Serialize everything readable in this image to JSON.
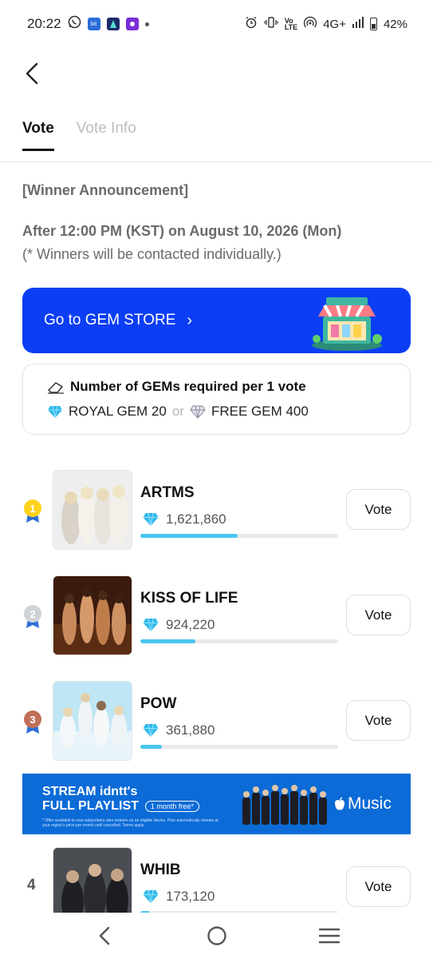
{
  "status_bar": {
    "time": "20:22",
    "network": "4G+",
    "battery": "42%"
  },
  "tabs": [
    {
      "label": "Vote",
      "active": true
    },
    {
      "label": "Vote Info",
      "active": false
    }
  ],
  "announcement": {
    "title": "[Winner Announcement]",
    "date": "After 12:00 PM (KST) on August 10, 2026 (Mon)",
    "note": "(* Winners will be contacted individually.)"
  },
  "gem_store": {
    "label": "Go to GEM STORE",
    "chevron": "›",
    "color": "#0b3ef5"
  },
  "gem_requirement": {
    "title": "Number of GEMs required per 1 vote",
    "royal": "ROYAL GEM 20",
    "or": "or",
    "free": "FREE GEM 400"
  },
  "vote_button_label": "Vote",
  "candidates": [
    {
      "rank": "1",
      "name": "ARTMS",
      "votes": "1,621,860",
      "progress": 0.49,
      "medal": "gold"
    },
    {
      "rank": "2",
      "name": "KISS OF LIFE",
      "votes": "924,220",
      "progress": 0.28,
      "medal": "silver"
    },
    {
      "rank": "3",
      "name": "POW",
      "votes": "361,880",
      "progress": 0.11,
      "medal": "bronze"
    },
    {
      "rank": "4",
      "name": "WHIB",
      "votes": "173,120",
      "progress": 0.05,
      "medal": "none"
    }
  ],
  "ad": {
    "line1": "STREAM idntt's",
    "line2": "FULL PLAYLIST",
    "pill": "1 month free*",
    "fine_print": "* Offer available to new subscribers who redeem on an eligible device. Plan automatically renews at your region's price per month until cancelled. Terms apply.",
    "brand": "Music"
  },
  "colors": {
    "accent": "#0b3ef5",
    "progress": "#49c6ee",
    "gem": "#2fb8ea"
  }
}
